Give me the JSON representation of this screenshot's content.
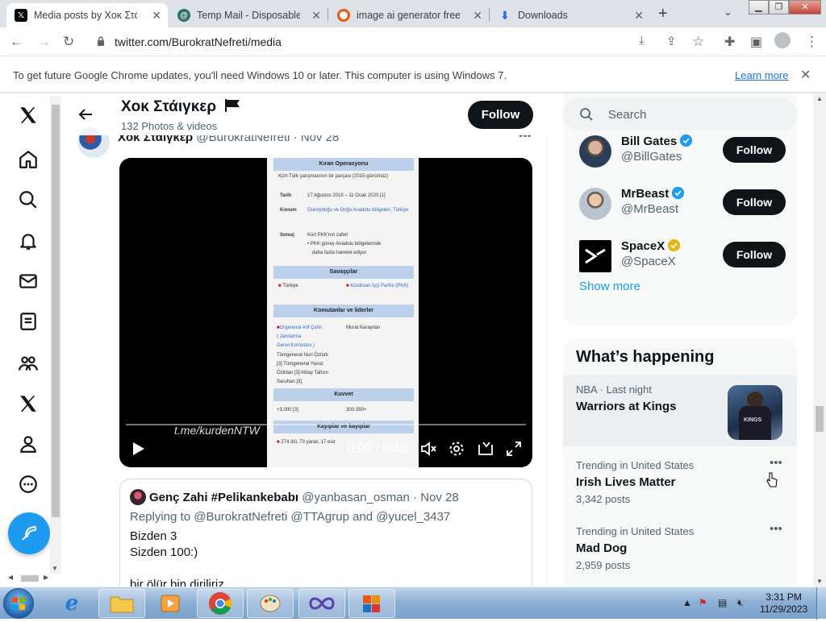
{
  "browser": {
    "tabs": [
      {
        "title": "Media posts by Χοκ Στάιγ",
        "active": true
      },
      {
        "title": "Temp Mail - Disposable T",
        "active": false
      },
      {
        "title": "image ai generator free a",
        "active": false
      },
      {
        "title": "Downloads",
        "active": false
      }
    ],
    "url": "twitter.com/BurokratNefreti/media",
    "infobar": {
      "message": "To get future Google Chrome updates, you'll need Windows 10 or later. This computer is using Windows 7.",
      "link": "Learn more"
    }
  },
  "profile": {
    "name": "Χοκ Στάιγκερ",
    "subtitle": "132 Photos & videos",
    "follow_label": "Follow"
  },
  "post": {
    "author": "Χοκ Στάιγκερ",
    "handle": "@BurokratNefreti",
    "date": "· Nov 28",
    "video": {
      "watermark": "t.me/kurdenNTW",
      "time": "0:00 / 0:16",
      "progress": 0.0,
      "doc_title": "Kıran Operasyonu",
      "doc_subtitle": "Kürt-Türk çatışmasının bir parçası (2015-günümüz)",
      "rows": [
        {
          "label": "Tarih",
          "value": "17 Ağustos 2019 – 11 Ocak 2020 [1]"
        },
        {
          "label": "Konum",
          "value": "Güneydoğu ve Doğu Anadolu bölgeleri, Türkiye"
        },
        {
          "label": "Sonuç",
          "value": "Kürt PKK'nın zaferi"
        },
        {
          "label": "",
          "value": "• PKK güney Anadolu bölgelerinde"
        },
        {
          "label": "",
          "value": "daha fazla hareket ediyor"
        }
      ],
      "sections": [
        "Savaşçılar",
        "Komutanlar ve liderler",
        "Kuvvet",
        "Kayıplar ve kayıplar"
      ],
      "belligerents": [
        "Türkiye",
        "Kürdistan İşçi Partisi (PKK)"
      ],
      "commanders_left": [
        "Orgeneral Arif Çetin",
        "( Jandarma",
        "Genel Komutanı )",
        "Tümgeneral Nuri Öztürk",
        "[3] Tümgeneral Yavuz",
        "Özildan [3] Albay Tahsin",
        "Saruhan [3]"
      ],
      "commander_right": "Murat Karayılan",
      "strength": [
        "+3.000 [3]",
        "300-350+"
      ],
      "casualties": [
        "274 ölü, 73 yaralı, 17 esir"
      ]
    }
  },
  "quote": {
    "name": "Genç Zahi #Pelikankebabı",
    "handle": "@yanbasan_osman",
    "date": "· Nov 28",
    "reply": "Replying to @BurokratNefreti @TTAgrup and @yucel_3437",
    "lines": [
      "Bizden 3",
      "Sizden 100:)",
      "",
      "bir ölür bin diriliriz"
    ]
  },
  "right": {
    "search_placeholder": "Search",
    "who_to_follow": [
      {
        "name": "Bill Gates",
        "handle": "@BillGates",
        "badge": "blue",
        "follow": "Follow"
      },
      {
        "name": "MrBeast",
        "handle": "@MrBeast",
        "badge": "blue",
        "follow": "Follow"
      },
      {
        "name": "SpaceX",
        "handle": "@SpaceX",
        "badge": "gold",
        "follow": "Follow"
      }
    ],
    "show_more": "Show more",
    "whats_happening": "What’s happening",
    "trends": [
      {
        "context": "NBA · Last night",
        "title": "Warriors at Kings",
        "count": ""
      },
      {
        "context": "Trending in United States",
        "title": "Irish Lives Matter",
        "count": "3,342 posts"
      },
      {
        "context": "Trending in United States",
        "title": "Mad Dog",
        "count": "2,959 posts"
      }
    ]
  },
  "taskbar": {
    "time": "3:31 PM",
    "date": "11/29/2023"
  },
  "colors": {
    "accent": "#1d9bf0",
    "dark": "#0f1419",
    "muted": "#536471",
    "verified_gold": "#e2b719"
  }
}
